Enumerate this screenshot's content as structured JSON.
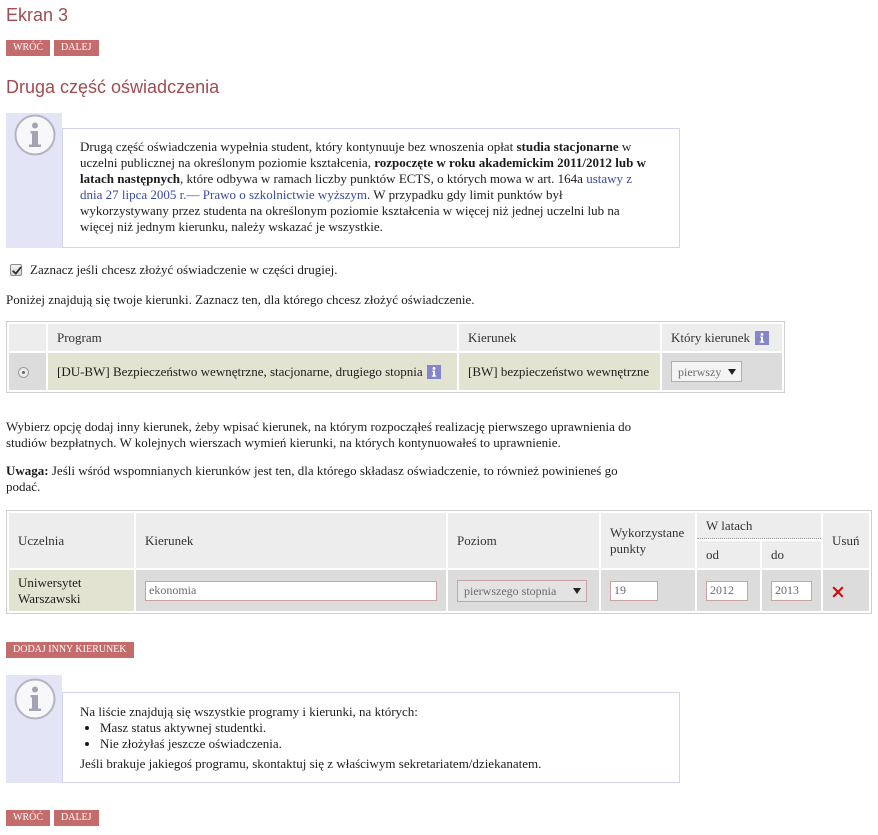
{
  "page": {
    "title": "Ekran 3",
    "section_title": "Druga część oświadczenia"
  },
  "nav_top": {
    "back": "WRÓĆ",
    "next": "DALEJ"
  },
  "nav_bottom": {
    "back": "WRÓĆ",
    "next": "DALEJ"
  },
  "info1": {
    "text_1": "Drugą część oświadczenia wypełnia student, który kontynuuje bez wnoszenia opłat ",
    "bold_1": "studia stacjonarne",
    "text_2": " w uczelni publicznej na określonym poziomie kształcenia, ",
    "bold_2": "rozpoczęte w roku akademickim 2011/2012 lub w latach następnych",
    "text_3": ", które odbywa w ramach liczby punktów ECTS, o których mowa w art. 164a ",
    "link": "ustawy z dnia 27 lipca 2005 r.— Prawo o szkolnictwie wyższym",
    "text_4": ". W przypadku gdy limit punktów był wykorzystywany przez studenta na określonym poziomie kształcenia w więcej niż jednej uczelni lub na więcej niż jednym kierunku, należy wskazać je wszystkie."
  },
  "checkbox": {
    "label": "Zaznacz jeśli chcesz złożyć oświadczenie w części drugiej.",
    "checked": true
  },
  "intro": "Poniżej znajdują się twoje kierunki. Zaznacz ten, dla którego chcesz złożyć oświadczenie.",
  "table1": {
    "headers": {
      "program": "Program",
      "kierunek": "Kierunek",
      "ktory": "Który kierunek"
    },
    "rows": [
      {
        "selected": true,
        "program": "[DU-BW] Bezpieczeństwo wewnętrzne, stacjonarne, drugiego stopnia",
        "kierunek": "[BW] bezpieczeństwo wewnętrzne",
        "ktory": "pierwszy"
      }
    ]
  },
  "instructions": "Wybierz opcję dodaj inny kierunek, żeby wpisać kierunek, na którym rozpocząłeś realizację pierwszego uprawnienia do studiów bezpłatnych. W kolejnych wierszach wymień kierunki, na których kontynuowałeś to uprawnienie.",
  "note": {
    "label": "Uwaga:",
    "text": " Jeśli wśród wspomnianych kierunków jest ten, dla którego składasz oświadczenie, to również powinieneś go podać."
  },
  "table2": {
    "headers": {
      "uczelnia": "Uczelnia",
      "kierunek": "Kierunek",
      "poziom": "Poziom",
      "punkty": "Wykorzystane punkty",
      "w_latach": "W latach",
      "od": "od",
      "do": "do",
      "usun": "Usuń"
    },
    "rows": [
      {
        "uczelnia": "Uniwersytet Warszawski",
        "kierunek": "ekonomia",
        "poziom": "pierwszego stopnia",
        "punkty": "19",
        "od": "2012",
        "do": "2013"
      }
    ]
  },
  "add_button": "DODAJ INNY KIERUNEK",
  "info2": {
    "intro": "Na liście znajdują się wszystkie programy i kierunki, na których:",
    "items": [
      "Masz status aktywnej studentki.",
      "Nie złożyłaś jeszcze oświadczenia."
    ],
    "outro": "Jeśli brakuje jakiegoś programu, skontaktuj się z właściwym sekretariatem/dziekanatem."
  },
  "icons": {
    "info_large": "info-circle-icon",
    "info_small": "info-square-icon",
    "dropdown": "dropdown-arrow-icon",
    "remove": "remove-x-icon",
    "checkbox": "check-icon"
  },
  "colors": {
    "accent": "#a24b50",
    "button_bg": "#c46b6c",
    "info_panel": "#e4e4f7",
    "info_badge": "#8585cc",
    "link": "#3a4aa0",
    "remove_icon": "#d40000"
  }
}
